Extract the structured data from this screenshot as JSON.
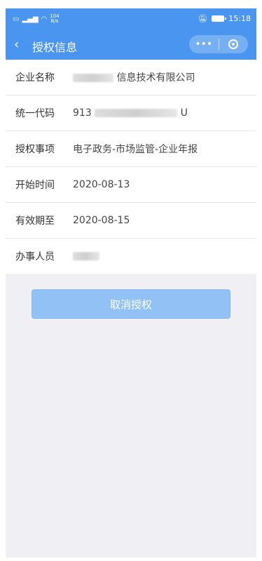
{
  "status": {
    "network_speed_value": "104",
    "network_speed_unit": "B/s",
    "time": "15:18"
  },
  "nav": {
    "back_icon": "chevron-left",
    "title": "授权信息",
    "more_icon": "•••",
    "target_icon": "target"
  },
  "rows": [
    {
      "label": "企业名称",
      "value_suffix": "信息技术有限公司"
    },
    {
      "label": "统一代码",
      "value_prefix": "913",
      "value_suffix": "U"
    },
    {
      "label": "授权事项",
      "value": "电子政务-市场监管-企业年报"
    },
    {
      "label": "开始时间",
      "value": "2020-08-13"
    },
    {
      "label": "有效期至",
      "value": "2020-08-15"
    },
    {
      "label": "办事人员"
    }
  ],
  "actions": {
    "cancel_label": "取消授权"
  },
  "colors": {
    "header": "#4a95ef",
    "button": "#91c1f5"
  }
}
